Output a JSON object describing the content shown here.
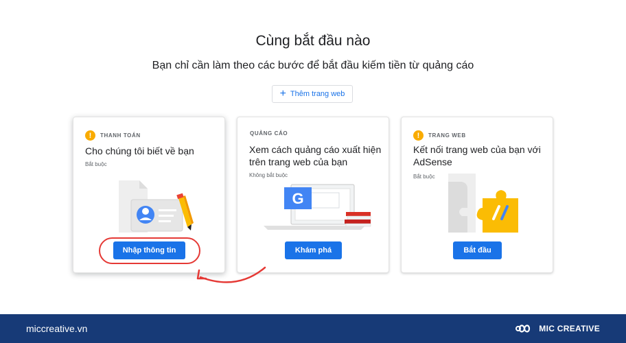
{
  "header": {
    "title": "Cùng bắt đầu nào",
    "subtitle": "Bạn chỉ cần làm theo các bước để bắt đầu kiếm tiền từ quảng cáo",
    "add_site_label": "Thêm trang web"
  },
  "cards": [
    {
      "eyebrow": "THANH TOÁN",
      "title": "Cho chúng tôi biết về bạn",
      "note": "Bắt buộc",
      "button": "Nhập thông tin",
      "warning": true,
      "illustration": "profile-card-pencil"
    },
    {
      "eyebrow": "QUẢNG CÁO",
      "title": "Xem cách quảng cáo xuất hiện trên trang web của bạn",
      "note": "Không bắt buộc",
      "button": "Khám phá",
      "warning": false,
      "illustration": "laptop-google-books"
    },
    {
      "eyebrow": "TRANG WEB",
      "title": "Kết nối trang web của bạn với AdSense",
      "note": "Bắt buộc",
      "button": "Bắt đầu",
      "warning": true,
      "illustration": "puzzle-adsense"
    }
  ],
  "footer": {
    "site": "miccreative.vn",
    "brand": "MIC CREATIVE"
  },
  "colors": {
    "primary": "#1a73e8",
    "warning": "#f9ab00",
    "annotation": "#e53935",
    "footer_bg": "#173a77"
  }
}
